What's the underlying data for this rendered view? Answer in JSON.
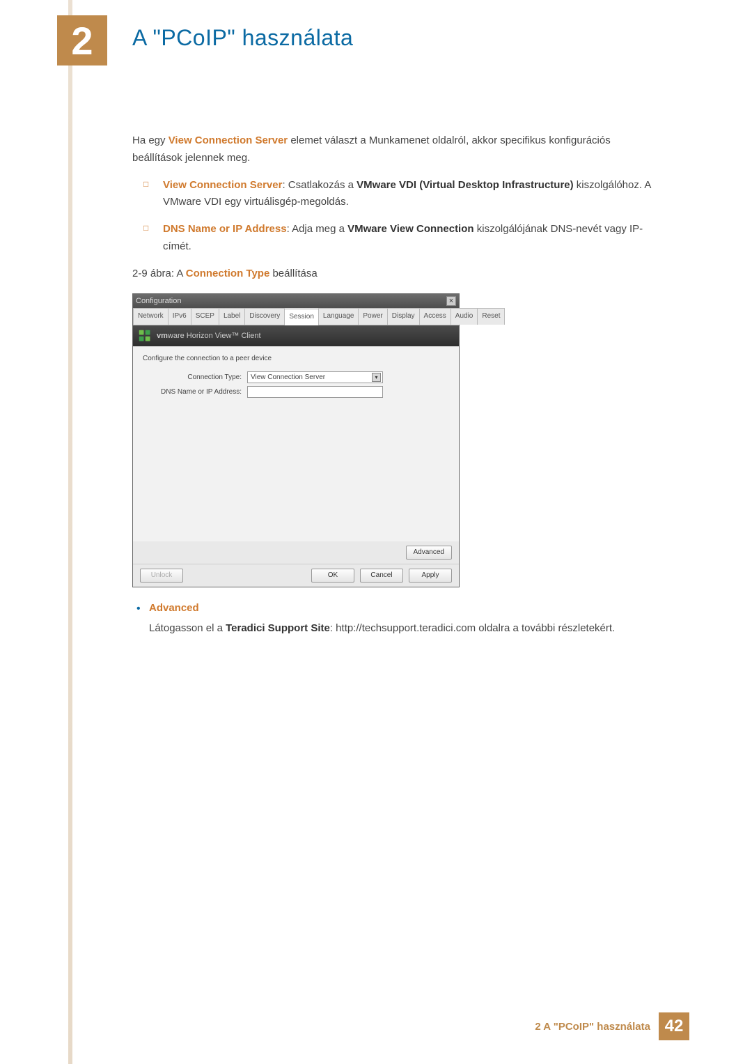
{
  "chapter": {
    "number": "2",
    "title": "A \"PCoIP\" használata"
  },
  "intro": {
    "pre": "Ha egy ",
    "strong1": "View Connection Server",
    "post": " elemet választ a Munkamenet oldalról, akkor specifikus konfigurációs beállítások jelennek meg."
  },
  "list1": [
    {
      "term": "View Connection Server",
      "sep": ": Csatlakozás a ",
      "bold": "VMware VDI (Virtual Desktop Infrastructure)",
      "rest": " kiszolgálóhoz. A VMware VDI egy virtuálisgép-megoldás."
    },
    {
      "term": "DNS Name or IP Address",
      "sep": ": Adja meg a ",
      "bold": "VMware View Connection",
      "rest": " kiszolgálójának DNS-nevét vagy IP-címét."
    }
  ],
  "figCaption": {
    "pre": "2-9 ábra: A ",
    "strong": "Connection Type",
    "post": " beállítása"
  },
  "dialog": {
    "title": "Configuration",
    "tabs": [
      "Network",
      "IPv6",
      "SCEP",
      "Label",
      "Discovery",
      "Session",
      "Language",
      "Power",
      "Display",
      "Access",
      "Audio",
      "Reset"
    ],
    "activeTab": "Session",
    "banner_label1": "vm",
    "banner_label2": "ware Horizon View™ Client",
    "instruction": "Configure the connection to a peer device",
    "field1_label": "Connection Type:",
    "field1_value": "View Connection Server",
    "field2_label": "DNS Name or IP Address:",
    "buttons": {
      "advanced": "Advanced",
      "unlock": "Unlock",
      "ok": "OK",
      "cancel": "Cancel",
      "apply": "Apply"
    }
  },
  "afterDialog": {
    "heading": "Advanced",
    "text_pre": "Látogasson el a ",
    "text_bold": "Teradici Support Site",
    "text_post": ": http://techsupport.teradici.com oldalra a további részletekért."
  },
  "footer": {
    "label": "2 A \"PCoIP\" használata",
    "page": "42"
  }
}
